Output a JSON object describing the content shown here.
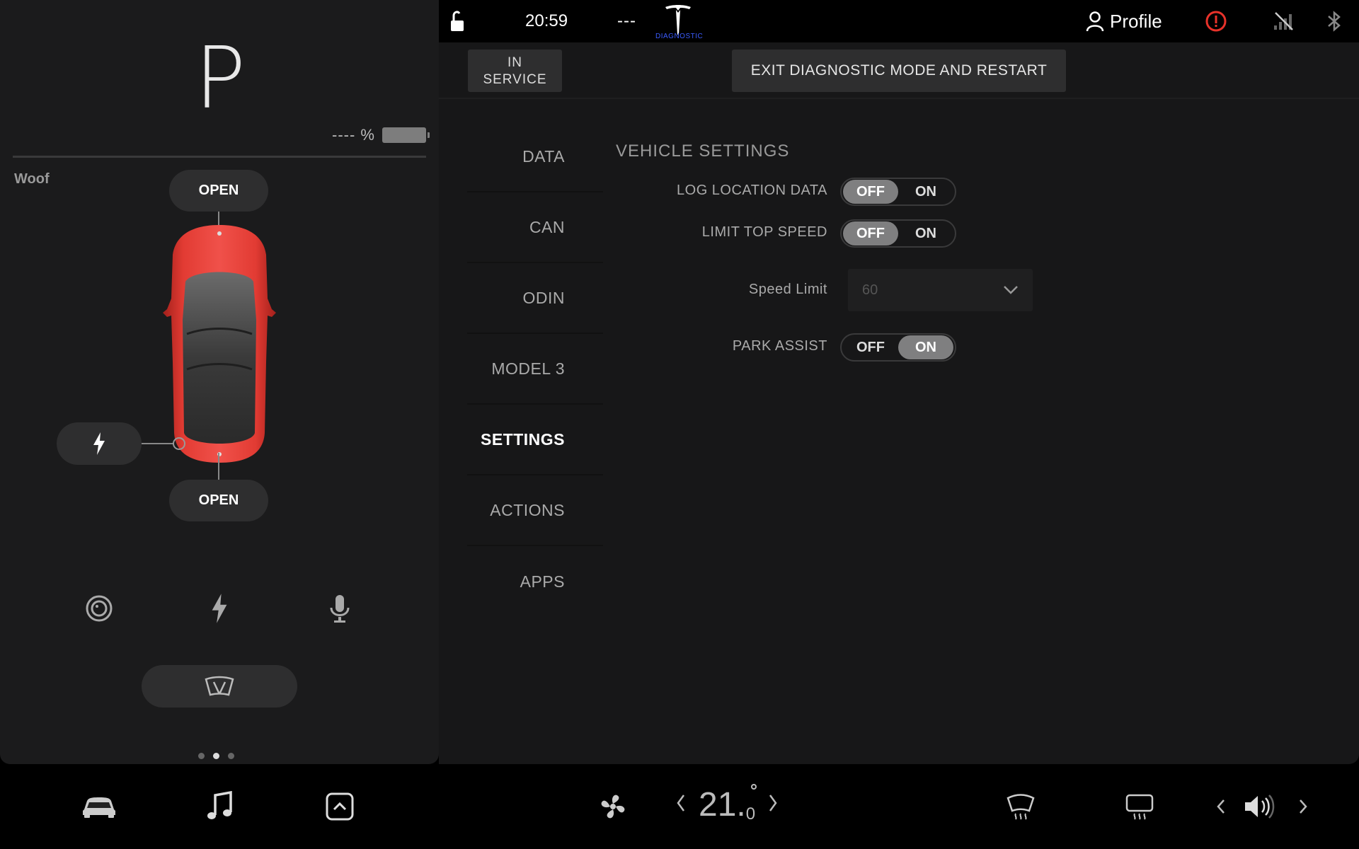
{
  "left_panel": {
    "gear": "P",
    "battery_percent": "---- %",
    "car_name": "Woof",
    "frunk_label": "OPEN",
    "trunk_label": "OPEN"
  },
  "status_bar": {
    "clock": "20:59",
    "range": "---",
    "diagnostic_label": "DIAGNOSTIC",
    "profile_label": "Profile"
  },
  "header": {
    "in_service_line1": "IN",
    "in_service_line2": "SERVICE",
    "exit_button": "EXIT DIAGNOSTIC MODE AND RESTART"
  },
  "nav": {
    "items": [
      {
        "label": "DATA"
      },
      {
        "label": "CAN"
      },
      {
        "label": "ODIN"
      },
      {
        "label": "MODEL 3"
      },
      {
        "label": "SETTINGS"
      },
      {
        "label": "ACTIONS"
      },
      {
        "label": "APPS"
      }
    ],
    "active": "SETTINGS"
  },
  "settings": {
    "section_title": "VEHICLE SETTINGS",
    "log_location": {
      "label": "LOG LOCATION DATA",
      "off": "OFF",
      "on": "ON",
      "value": "OFF"
    },
    "limit_top_speed": {
      "label": "LIMIT TOP SPEED",
      "off": "OFF",
      "on": "ON",
      "value": "OFF"
    },
    "speed_limit": {
      "label": "Speed Limit",
      "value": "60"
    },
    "park_assist": {
      "label": "PARK ASSIST",
      "off": "OFF",
      "on": "ON",
      "value": "ON"
    }
  },
  "climate": {
    "temp_whole": "21.",
    "temp_decimal": "0"
  },
  "colors": {
    "car_red": "#e23b33",
    "alert_red": "#e8322a",
    "toggle_selected": "#7f7f80",
    "diagnostic_blue": "#3b5cff"
  }
}
